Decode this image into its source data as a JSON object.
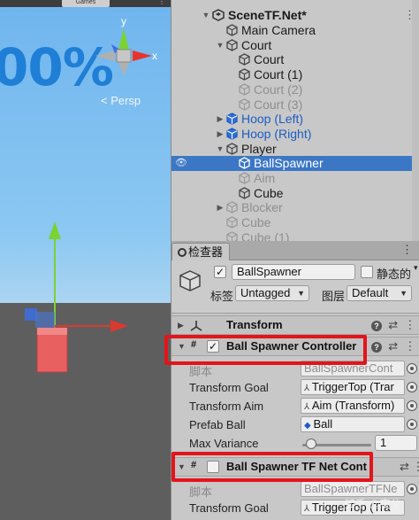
{
  "scene": {
    "tab_label": "Games",
    "big_text": "00%",
    "persp_label": "< Persp",
    "gizmo_axis_labels": {
      "y": "y",
      "x": "x"
    }
  },
  "hierarchy": {
    "scene_name": "SceneTF.Net*",
    "items": [
      {
        "label": "Main Camera",
        "icon": "gameobject-icon"
      },
      {
        "label": "Court",
        "icon": "gameobject-icon"
      },
      {
        "label": "Court",
        "icon": "gameobject-icon"
      },
      {
        "label": "Court (1)",
        "icon": "gameobject-icon"
      },
      {
        "label": "Court (2)",
        "icon": "gameobject-icon"
      },
      {
        "label": "Court (3)",
        "icon": "gameobject-icon"
      },
      {
        "label": "Hoop (Left)",
        "icon": "prefab-icon"
      },
      {
        "label": "Hoop (Right)",
        "icon": "prefab-icon"
      },
      {
        "label": "Player",
        "icon": "gameobject-icon"
      },
      {
        "label": "BallSpawner",
        "icon": "gameobject-icon"
      },
      {
        "label": "Aim",
        "icon": "gameobject-icon"
      },
      {
        "label": "Cube",
        "icon": "gameobject-icon"
      },
      {
        "label": "Blocker",
        "icon": "gameobject-icon"
      },
      {
        "label": "Cube",
        "icon": "gameobject-icon"
      },
      {
        "label": "Cube (1)",
        "icon": "gameobject-icon"
      }
    ]
  },
  "inspector": {
    "tab_label": "检查器",
    "object_name": "BallSpawner",
    "static_label": "静态的",
    "tag_label": "标签",
    "tag_value": "Untagged",
    "layer_label": "图层",
    "layer_value": "Default",
    "components": [
      {
        "title": "Transform"
      },
      {
        "title": "Ball Spawner Controller",
        "fields": [
          {
            "label": "脚本",
            "value": "BallSpawnerCont"
          },
          {
            "label": "Transform Goal",
            "value": "TriggerTop (Trar"
          },
          {
            "label": "Transform Aim",
            "value": "Aim (Transform)"
          },
          {
            "label": "Prefab Ball",
            "value": "Ball"
          },
          {
            "label": "Max Variance",
            "value": "1"
          }
        ]
      },
      {
        "title": "Ball Spawner TF Net Cont",
        "fields": [
          {
            "label": "脚本",
            "value": "BallSpawnerTFNe"
          },
          {
            "label": "Transform Goal",
            "value": "TriggerTop (Tra"
          }
        ]
      }
    ],
    "max_variance_slider_fraction": 0.05
  },
  "watermark": "知乎 @夜兮",
  "colors": {
    "selection": "#3b77c5",
    "highlight_box": "#e2151b",
    "prefab_blue": "#1e5cc2"
  }
}
